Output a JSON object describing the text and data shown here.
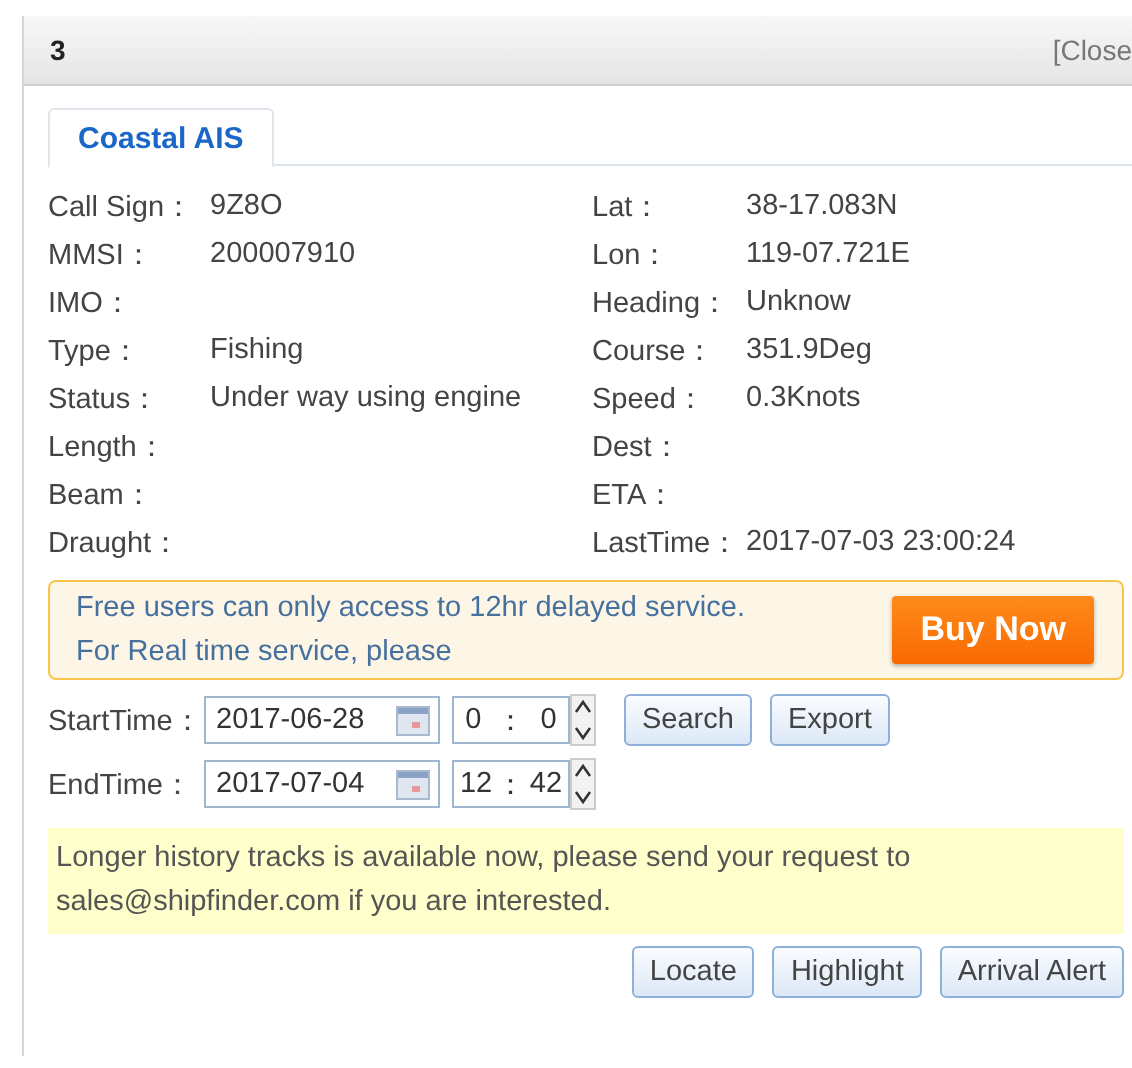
{
  "window": {
    "title": "3",
    "close": "[Close"
  },
  "tabs": [
    {
      "label": "Coastal AIS",
      "selected": true
    }
  ],
  "fields_left": [
    {
      "label": "Call Sign：",
      "value": "9Z8O"
    },
    {
      "label": "MMSI：",
      "value": "200007910"
    },
    {
      "label": "IMO："
    },
    {
      "label": "Type：",
      "value": "Fishing"
    },
    {
      "label": "Status：",
      "value": "Under way using engine"
    },
    {
      "label": "Length："
    },
    {
      "label": "Beam："
    },
    {
      "label": "Draught："
    }
  ],
  "fields_right": [
    {
      "label": "Lat：",
      "value": "38-17.083N"
    },
    {
      "label": "Lon：",
      "value": "119-07.721E"
    },
    {
      "label": "Heading：",
      "value": "Unknow"
    },
    {
      "label": "Course：",
      "value": "351.9Deg"
    },
    {
      "label": "Speed：",
      "value": "0.3Knots"
    },
    {
      "label": "Dest："
    },
    {
      "label": "ETA："
    },
    {
      "label": "LastTime：",
      "value": "2017-07-03 23:00:24"
    }
  ],
  "notice": {
    "lines": [
      "Free users can only access to 12hr delayed service.",
      "For Real time service, please"
    ],
    "button": "Buy Now"
  },
  "time_rows": [
    {
      "label": "StartTime：",
      "date": "2017-06-28",
      "hour": "0",
      "separator": "：",
      "minute": "0",
      "buttons": [
        "Search",
        "Export"
      ]
    },
    {
      "label": "EndTime：",
      "date": "2017-07-04",
      "hour": "12",
      "separator": "：",
      "minute": "42",
      "buttons": []
    }
  ],
  "history_note": "Longer history tracks is available now, please send your request to sales@shipfinder.com if you are interested.",
  "actions": [
    "Locate",
    "Highlight",
    "Arrival Alert"
  ]
}
